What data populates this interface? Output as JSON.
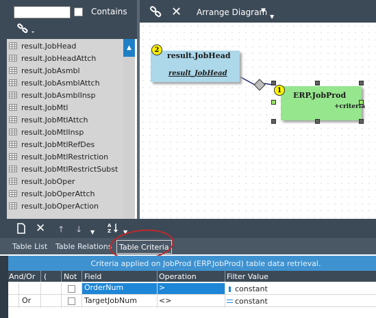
{
  "search": {
    "placeholder": "",
    "value": "",
    "contains_label": "Contains"
  },
  "table_list": [
    "result.JobHead",
    "result.JobHeadAttch",
    "result.JobAsmbl",
    "result.JobAsmblAttch",
    "result.JobAsmblInsp",
    "result.JobMtl",
    "result.JobMtlAttch",
    "result.JobMtlInsp",
    "result.JobMtlRefDes",
    "result.JobMtlRestriction",
    "result.JobMtlRestrictSubst",
    "result.JobOper",
    "result.JobOperAttch",
    "result.JobOperAction"
  ],
  "diagram_toolbar": {
    "arrange_label": "Arrange Diagram"
  },
  "diagram": {
    "node_jobhead": {
      "badge": "2",
      "title": "result.JobHead",
      "subtitle": "result_JobHead"
    },
    "node_jobprod": {
      "badge": "1",
      "title": "ERP.JobProd",
      "criteria": "+criteria"
    }
  },
  "tabs": {
    "list": "Table List",
    "relations": "Table Relations",
    "criteria": "Table Criteria"
  },
  "criteria": {
    "info": "Criteria applied on JobProd (ERP.JobProd)  table data retrieval.",
    "headers": {
      "andor": "And/Or",
      "paren": "(",
      "not": "Not",
      "field": "Field",
      "operation": "Operation",
      "filter": "Filter Value"
    },
    "rows": [
      {
        "andor": "",
        "field": "OrderNum",
        "operation": ">",
        "filter": "constant"
      },
      {
        "andor": "Or",
        "field": "TargetJobNum",
        "operation": "<>",
        "filter": "constant"
      }
    ]
  },
  "colors": {
    "toolbar": "#3c4a57",
    "accent": "#1e86d6",
    "node_blue": "#acd8ea",
    "node_green": "#96e68e",
    "badge": "#fff200",
    "annotation": "#c0282a"
  }
}
